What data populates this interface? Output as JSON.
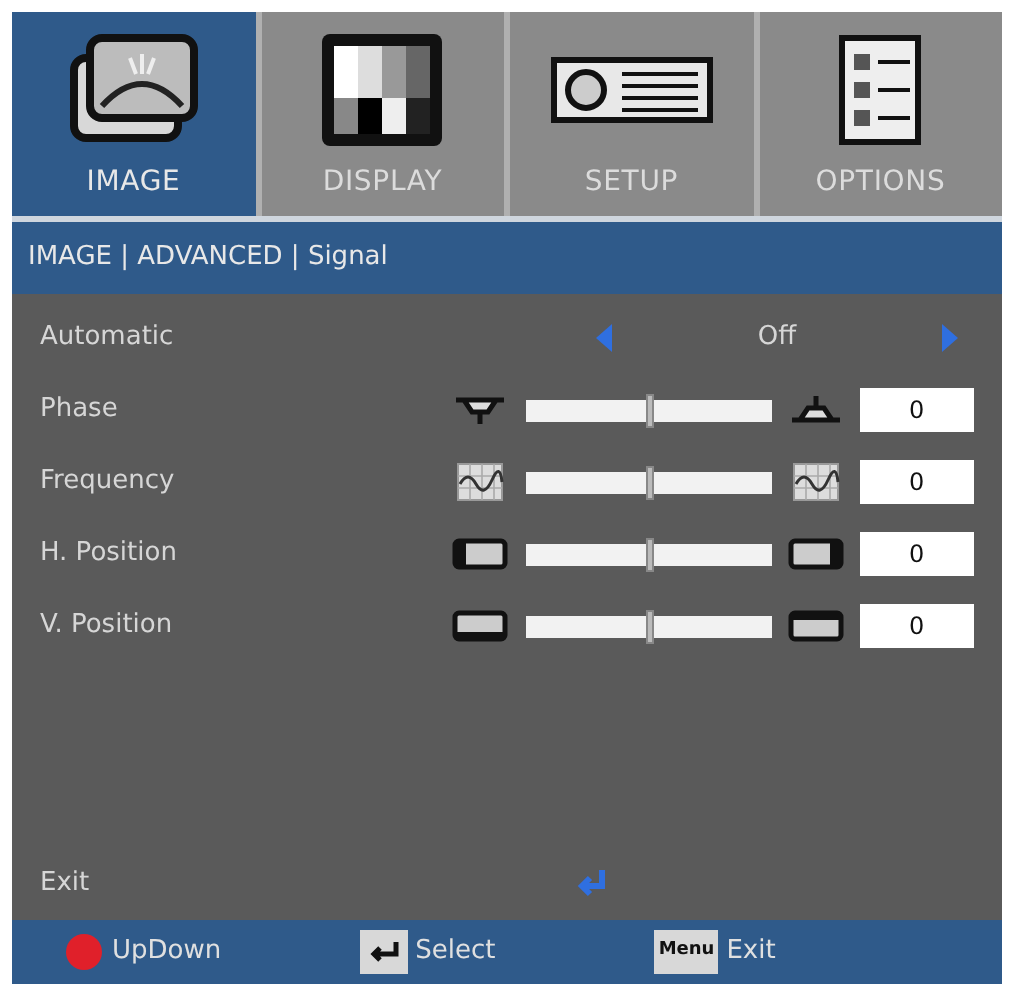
{
  "tabs": [
    {
      "label": "IMAGE",
      "kind": "image",
      "selected": true
    },
    {
      "label": "DISPLAY",
      "kind": "display",
      "selected": false
    },
    {
      "label": "SETUP",
      "kind": "setup",
      "selected": false
    },
    {
      "label": "OPTIONS",
      "kind": "options",
      "selected": false
    }
  ],
  "breadcrumb": "IMAGE | ADVANCED | Signal",
  "items": [
    {
      "kind": "choice",
      "label": "Automatic",
      "value": "Off"
    },
    {
      "kind": "phase",
      "label": "Phase",
      "level": 0.5,
      "value": "0"
    },
    {
      "kind": "frequency",
      "label": "Frequency",
      "level": 0.5,
      "value": "0"
    },
    {
      "kind": "hpos",
      "label": "H. Position",
      "level": 0.5,
      "value": "0"
    },
    {
      "kind": "vpos",
      "label": "V. Position",
      "level": 0.5,
      "value": "0"
    }
  ],
  "exit": {
    "label": "Exit"
  },
  "hints": [
    {
      "kind": "dpad",
      "label": "UpDown"
    },
    {
      "kind": "enter",
      "label": "Select"
    },
    {
      "kind": "menu",
      "key": "Menu",
      "label": "Exit"
    }
  ]
}
